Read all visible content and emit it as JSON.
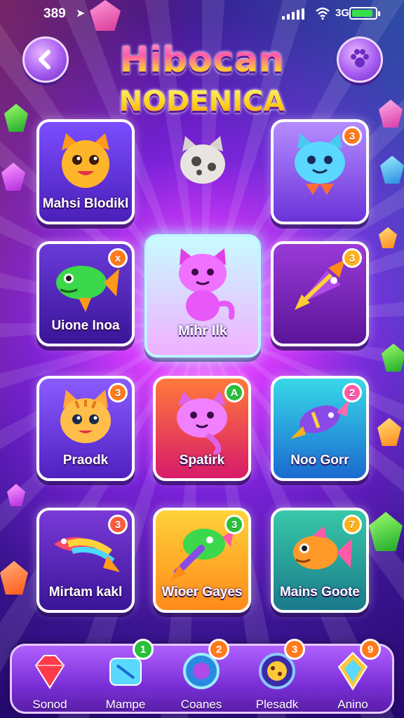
{
  "status_bar": {
    "time": "389",
    "network_type": "3G",
    "battery_level_percent": 90
  },
  "header": {
    "title_line_1": "Hibocan",
    "title_line_2": "NODENICA",
    "back_icon": "chevron-left-icon",
    "menu_icon": "paw-icon"
  },
  "cards": [
    {
      "label": "Mahsi Blodikl",
      "badge": "",
      "creature": "orange-cat",
      "colors": [
        "#7b4dff",
        "#4a1fb8"
      ]
    },
    {
      "label": "",
      "badge": "",
      "creature": "gray-cat",
      "colors": []
    },
    {
      "label": "",
      "badge": "3",
      "creature": "blue-cat-rocket",
      "colors": [
        "#b58cff",
        "#6a33d8"
      ]
    },
    {
      "label": "Uione Inoa",
      "badge": "x",
      "creature": "green-fish",
      "colors": [
        "#6a3ad8",
        "#3a1598"
      ]
    },
    {
      "label": "Mihr Ilk",
      "badge": "",
      "creature": "pink-cat",
      "colors": [
        "#c8fbff",
        "#f0b0ff"
      ]
    },
    {
      "label": "",
      "badge": "3",
      "creature": "rocket-fish",
      "colors": [
        "#9a3ad8",
        "#5a1598"
      ]
    },
    {
      "label": "Praodk",
      "badge": "3",
      "creature": "tabby-kitten",
      "colors": [
        "#8a5cff",
        "#5020c0"
      ]
    },
    {
      "label": "Spatirk",
      "badge": "A",
      "creature": "pink-axolotl",
      "colors": [
        "#ff7a3a",
        "#d81a6a"
      ]
    },
    {
      "label": "Noo Gorr",
      "badge": "2",
      "creature": "fish-rocket",
      "colors": [
        "#38d8e8",
        "#1a6ad0"
      ]
    },
    {
      "label": "Mirtam kakl",
      "badge": "3",
      "creature": "rainbow-rocket",
      "colors": [
        "#7a3ad8",
        "#3a1598"
      ]
    },
    {
      "label": "Wioer Gayes",
      "badge": "3",
      "creature": "green-rocket",
      "colors": [
        "#ffd23a",
        "#ff8a1a"
      ]
    },
    {
      "label": "Mains Goote",
      "badge": "7",
      "creature": "goldfish",
      "colors": [
        "#38c8a8",
        "#1a7a8a"
      ]
    }
  ],
  "bottom_nav": [
    {
      "label": "Sonod",
      "badge": "",
      "icon": "red-gem-icon"
    },
    {
      "label": "Mampe",
      "badge": "1",
      "icon": "map-icon"
    },
    {
      "label": "Coanes",
      "badge": "2",
      "icon": "portal-icon"
    },
    {
      "label": "Plesadk",
      "badge": "3",
      "icon": "cookie-icon"
    },
    {
      "label": "Anino",
      "badge": "9",
      "icon": "crystal-icon"
    }
  ]
}
